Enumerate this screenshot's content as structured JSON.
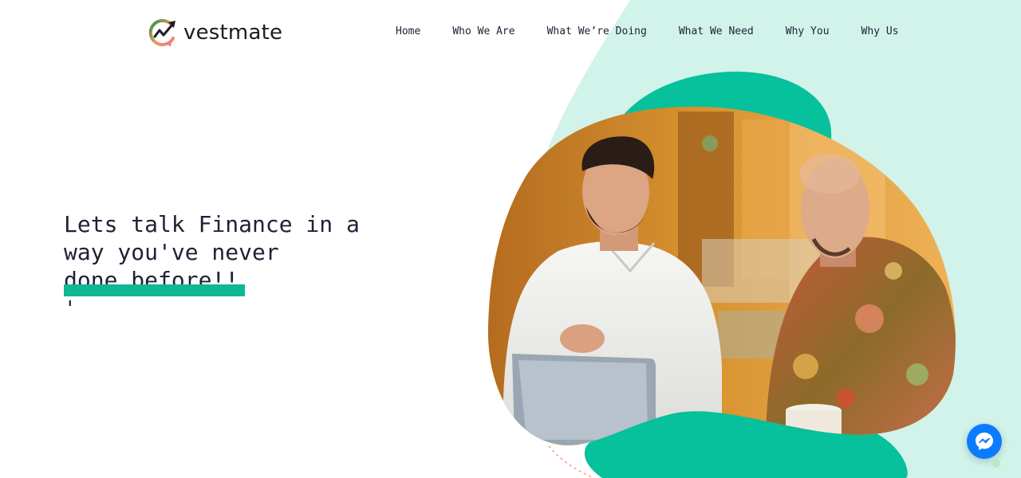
{
  "brand": {
    "name": "vestmate",
    "accent": "#0fb795",
    "mint": "#d1f3eb",
    "teal": "#06c19c"
  },
  "nav": {
    "items": [
      {
        "label": "Home"
      },
      {
        "label": "Who We Are"
      },
      {
        "label": "What We’re Doing"
      },
      {
        "label": "What We Need"
      },
      {
        "label": "Why You"
      },
      {
        "label": "Why Us"
      }
    ]
  },
  "hero": {
    "line1": "Lets talk Finance in a",
    "line2": "way you've never",
    "line3": "done before!!",
    "cursor": "'"
  },
  "chat": {
    "icon": "messenger-icon"
  }
}
